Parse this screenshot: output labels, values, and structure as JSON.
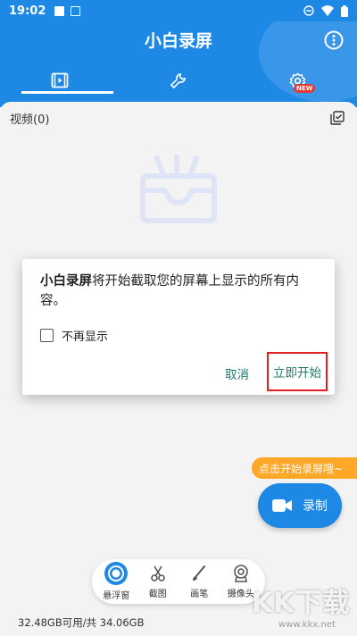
{
  "status_bar": {
    "time": "19:02",
    "battery_icon": "battery-icon",
    "wifi_icon": "wifi-icon",
    "dnd_icon": "dnd-icon"
  },
  "header": {
    "title": "小白录屏",
    "accent_color": "#1e88e5"
  },
  "tabs": [
    {
      "name": "videos",
      "icon": "video-library-icon",
      "active": true
    },
    {
      "name": "tools",
      "icon": "wrench-icon",
      "active": false
    },
    {
      "name": "settings",
      "icon": "gear-icon",
      "active": false,
      "badge": "NEW"
    }
  ],
  "main": {
    "video_label": "视频(0)"
  },
  "dialog": {
    "app_name": "小白录屏",
    "message": "将开始截取您的屏幕上显示的所有内容。",
    "checkbox_label": "不再显示",
    "checkbox_checked": false,
    "cancel_label": "取消",
    "start_label": "立即开始"
  },
  "hint": "点击开始录屏哦~",
  "record_button": {
    "label": "录制"
  },
  "toolbar": [
    {
      "label": "悬浮窗",
      "icon": "floating-window-icon"
    },
    {
      "label": "截图",
      "icon": "scissors-icon"
    },
    {
      "label": "画笔",
      "icon": "brush-icon"
    },
    {
      "label": "摄像头",
      "icon": "camera-head-icon"
    }
  ],
  "storage": "32.48GB可用/共 34.06GB",
  "watermark": {
    "text": "KK下载",
    "url": "www.kkx.net"
  }
}
